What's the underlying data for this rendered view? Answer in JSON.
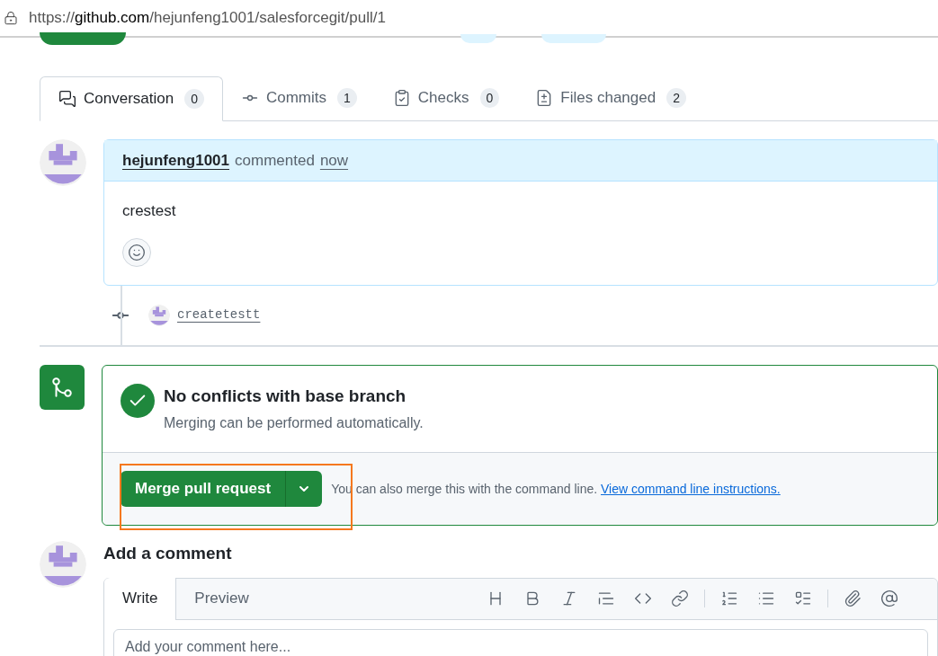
{
  "address_bar": {
    "url_host_prefix": "https://",
    "url_host": "github.com",
    "url_path": "/hejunfeng1001/salesforcegit/pull/1"
  },
  "tabs": [
    {
      "kind": "conversation",
      "label": "Conversation",
      "count": "0",
      "selected": true
    },
    {
      "kind": "commits",
      "label": "Commits",
      "count": "1",
      "selected": false
    },
    {
      "kind": "checks",
      "label": "Checks",
      "count": "0",
      "selected": false
    },
    {
      "kind": "files",
      "label": "Files changed",
      "count": "2",
      "selected": false
    }
  ],
  "comment": {
    "author": "hejunfeng1001",
    "action": "commented",
    "time": "now",
    "body": "crestest"
  },
  "commit": {
    "message": "createtestt"
  },
  "merge_box": {
    "title": "No conflicts with base branch",
    "subtitle": "Merging can be performed automatically.",
    "button": "Merge pull request",
    "hint": "You can also merge this with the command line.",
    "link": "View command line instructions.",
    "highlighted": true
  },
  "add_comment": {
    "title": "Add a comment",
    "tabs": [
      {
        "label": "Write",
        "selected": true
      },
      {
        "label": "Preview",
        "selected": false
      }
    ],
    "toolbar": [
      {
        "kind": "heading"
      },
      {
        "kind": "bold"
      },
      {
        "kind": "italic"
      },
      {
        "kind": "quote"
      },
      {
        "kind": "code"
      },
      {
        "kind": "link"
      },
      {
        "kind": "divider"
      },
      {
        "kind": "ordered"
      },
      {
        "kind": "unordered"
      },
      {
        "kind": "tasks"
      },
      {
        "kind": "divider"
      },
      {
        "kind": "attach"
      },
      {
        "kind": "mention"
      }
    ],
    "placeholder": "Add your comment here..."
  }
}
